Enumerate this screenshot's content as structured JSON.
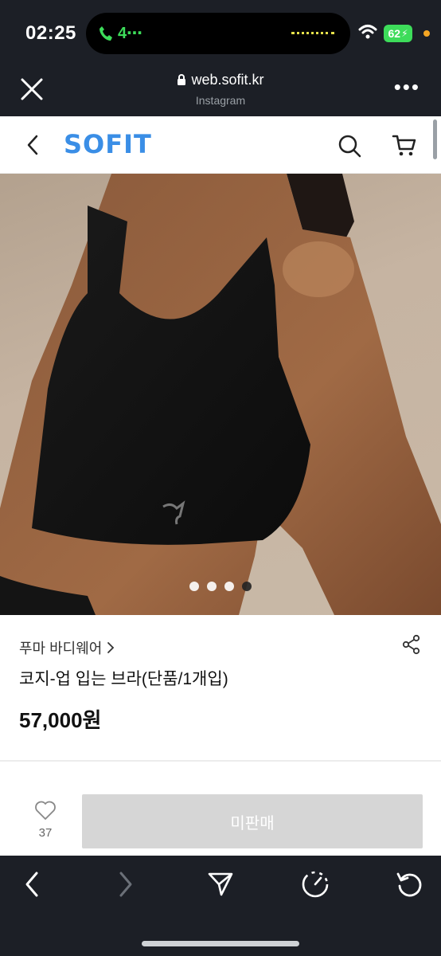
{
  "status_bar": {
    "time": "02:25",
    "call_label": "4⋯",
    "battery": "62"
  },
  "browser": {
    "url": "web.sofit.kr",
    "source": "Instagram",
    "more": "•••"
  },
  "site": {
    "logo": "SOFIT",
    "accent_color": "#3a8ee6"
  },
  "carousel": {
    "total_slides": 4,
    "active_slide": 4
  },
  "product": {
    "brand": "푸마 바디웨어",
    "name": "코지-업 입는 브라(단품/1개입)",
    "price": "57,000원"
  },
  "action_bar": {
    "like_count": "37",
    "buy_label": "미판매"
  },
  "icons": {
    "close": "close-icon",
    "lock": "lock-icon",
    "more": "more-icon",
    "back": "back-icon",
    "search": "search-icon",
    "cart": "cart-icon",
    "share": "share-icon",
    "heart": "heart-icon",
    "nav_back": "chevron-left-icon",
    "nav_forward": "chevron-right-icon",
    "send": "send-icon",
    "speed": "gauge-icon",
    "reload": "reload-icon"
  }
}
